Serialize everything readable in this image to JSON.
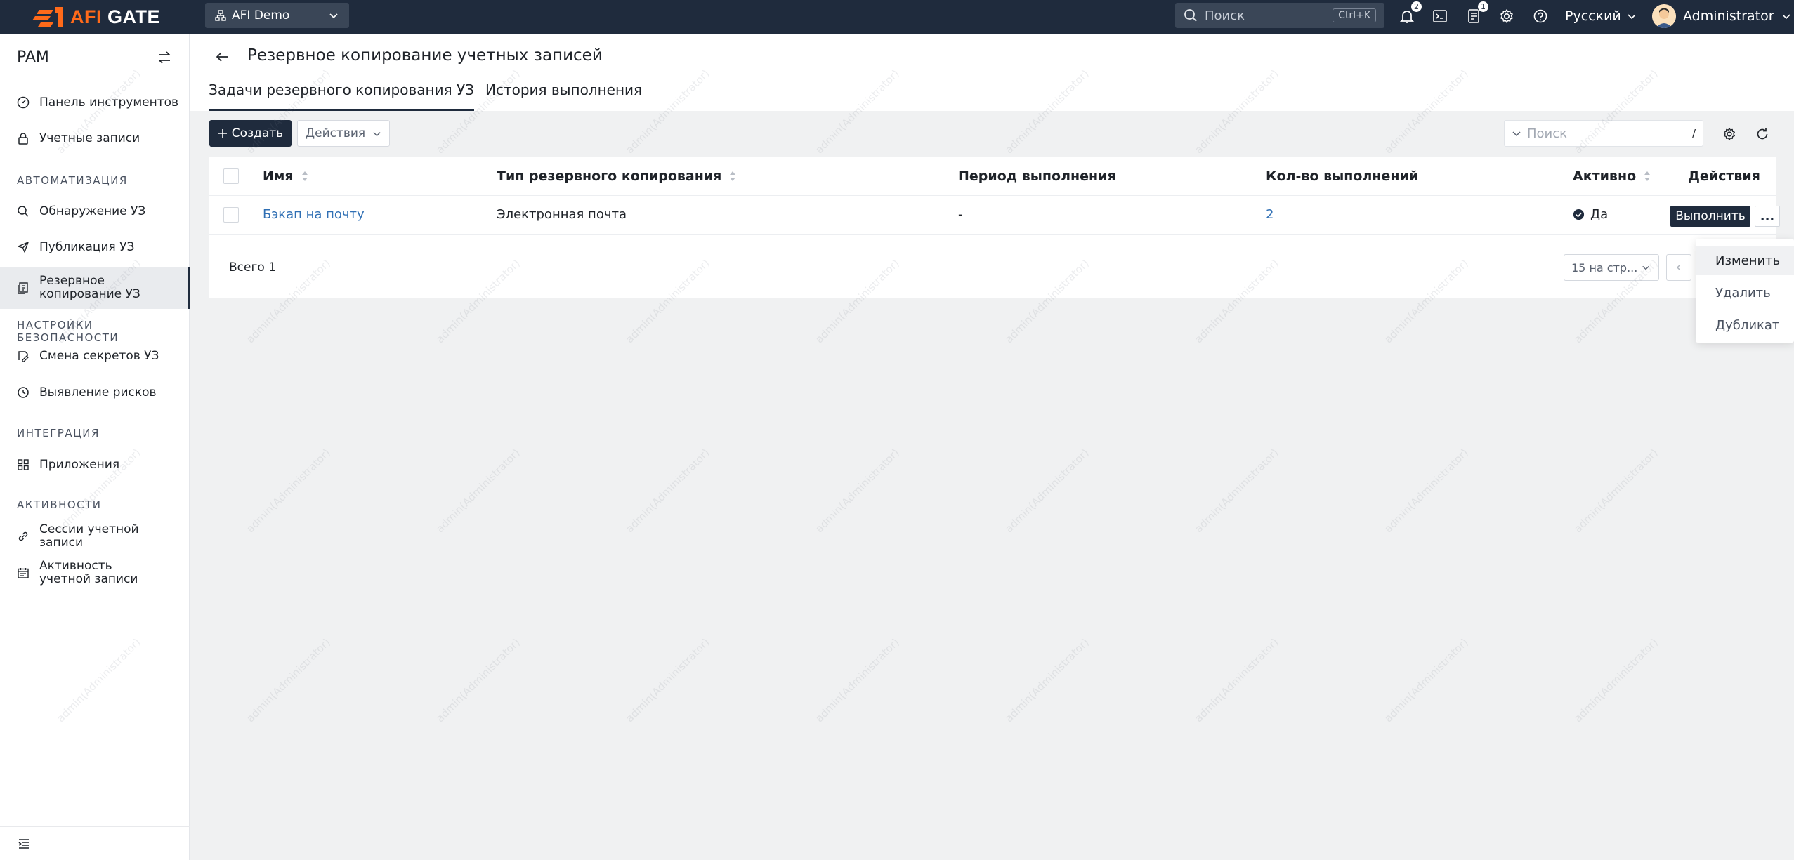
{
  "topbar": {
    "logo_prefix": "AFI",
    "logo_suffix": " GATE",
    "org": "AFI Demo",
    "search_placeholder": "Поиск",
    "search_shortcut": "Ctrl+K",
    "notifications_count": "2",
    "tasks_count": "1",
    "language": "Русский",
    "user": "Administrator"
  },
  "sidebar": {
    "title": "PAM",
    "items": {
      "dashboard": "Панель инструментов",
      "accounts": "Учетные записи",
      "discovery": "Обнаружение УЗ",
      "publication": "Публикация УЗ",
      "backup": "Резервное копирование УЗ",
      "secret_change": "Смена секретов УЗ",
      "risk": "Выявление рисков",
      "apps": "Приложения",
      "sessions": "Сессии учетной записи",
      "activity": "Активность учетной записи"
    },
    "sections": {
      "automation": "АВТОМАТИЗАЦИЯ",
      "security": "НАСТРОЙКИ БЕЗОПАСНОСТИ",
      "integration": "ИНТЕГРАЦИЯ",
      "activities": "АКТИВНОСТИ"
    }
  },
  "page": {
    "title": "Резервное копирование учетных записей",
    "tabs": [
      "Задачи резервного копирования УЗ",
      "История выполнения"
    ]
  },
  "toolbar": {
    "create": "Создать",
    "actions": "Действия",
    "search_placeholder": "Поиск",
    "search_shortcut": "/"
  },
  "table": {
    "columns": [
      "Имя",
      "Тип резервного копирования",
      "Период выполнения",
      "Кол-во выполнений",
      "Активно",
      "Действия"
    ],
    "rows": [
      {
        "name": "Бэкап на почту",
        "type": "Электронная почта",
        "period": "-",
        "runs": "2",
        "active": "Да",
        "run_label": "Выполнить",
        "more_label": "..."
      }
    ],
    "total": "Всего 1",
    "page_size": "15 на стр..."
  },
  "dropdown": {
    "items": [
      "Изменить",
      "Удалить",
      "Дубликат"
    ]
  },
  "watermark": "admin(Administrator)"
}
